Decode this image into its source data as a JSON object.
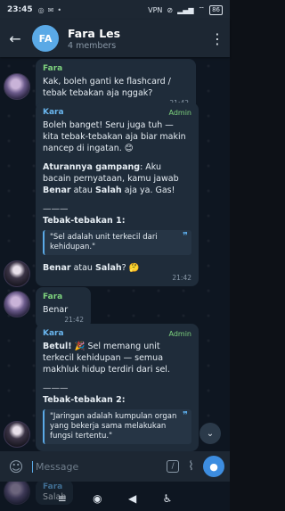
{
  "status": {
    "time": "23:45",
    "left_icons": [
      "whatsapp-icon",
      "mail-icon",
      "dot"
    ],
    "right_text": "VPN",
    "battery": "86"
  },
  "header": {
    "back_icon": "arrow-left-icon",
    "avatar_initials": "FA",
    "title": "Fara Les",
    "subtitle": "4 members",
    "menu_icon": "more-vertical-icon"
  },
  "messages": {
    "m1": {
      "sender": "Fara",
      "text": "Kak, boleh ganti ke flashcard / tebak tebakan aja nggak?",
      "time": "21:42"
    },
    "m2": {
      "sender": "Kara",
      "badge": "Admin",
      "p1": "Boleh banget! Seru juga tuh — kita tebak-tebakan aja biar makin nancep di ingatan. 😊",
      "rules_bold": "Aturannya gampang",
      "rules_a": ": Aku bacain pernyataan, kamu jawab ",
      "benar": "Benar",
      "atau": " atau ",
      "salah": "Salah",
      "rules_b": " aja ya. Gas!",
      "divider": "———",
      "heading": "Tebak-tebakan 1:",
      "quote": "\"Sel adalah unit terkecil dari kehidupan.\"",
      "question_benar": "Benar",
      "question_mid": " atau ",
      "question_salah": "Salah",
      "question_end": "? 🤔",
      "time": "21:42"
    },
    "m3": {
      "sender": "Fara",
      "text": "Benar",
      "time": "21:42"
    },
    "m4": {
      "sender": "Kara",
      "badge": "Admin",
      "betul": "Betul!",
      "p1": " 🎉 Sel memang unit terkecil kehidupan — semua makhluk hidup terdiri dari sel.",
      "divider": "———",
      "heading": "Tebak-tebakan 2:",
      "quote": "\"Jaringan adalah kumpulan organ yang bekerja sama melakukan fungsi tertentu.\""
    },
    "behind": {
      "sender": "Fara",
      "text": "Salah"
    }
  },
  "input": {
    "placeholder": "Message",
    "emoji_icon": "emoji-icon",
    "command_icon": "slash-command-icon",
    "attach_icon": "paperclip-icon",
    "mic_icon": "microphone-icon"
  },
  "colors": {
    "accent": "#5aa9e6",
    "admin": "#7ed37e",
    "bubble": "#1f2c3a",
    "chat_bg": "#0e1621",
    "header_bg": "#1d2733"
  }
}
